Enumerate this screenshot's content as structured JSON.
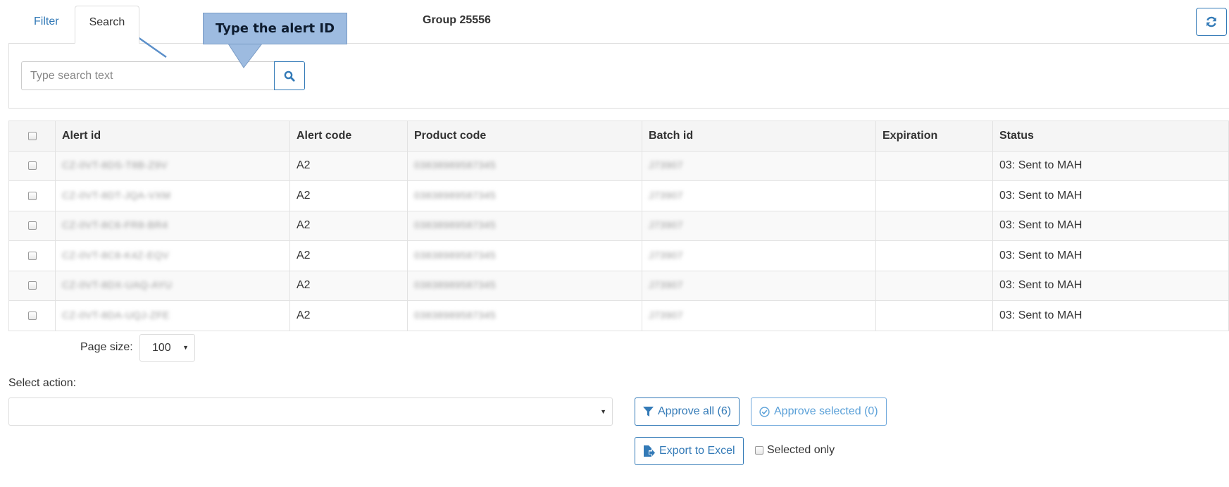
{
  "tabs": [
    {
      "label": "Filter",
      "active": false
    },
    {
      "label": "Search",
      "active": true
    }
  ],
  "group_title": "Group 25556",
  "callout": {
    "text": "Type the alert ID"
  },
  "search": {
    "placeholder": "Type search text",
    "value": ""
  },
  "table": {
    "columns": [
      "Alert id",
      "Alert code",
      "Product code",
      "Batch id",
      "Expiration",
      "Status"
    ],
    "rows": [
      {
        "alert_id": "CZ-0VT-8DS-T8B-Z9V",
        "alert_code": "A2",
        "product_code": "03838989587345",
        "batch_id": "J73907",
        "expiration": "",
        "status": "03: Sent to MAH"
      },
      {
        "alert_id": "CZ-0VT-8DT-JQA-VXM",
        "alert_code": "A2",
        "product_code": "03838989587345",
        "batch_id": "J73907",
        "expiration": "",
        "status": "03: Sent to MAH"
      },
      {
        "alert_id": "CZ-0VT-8C6-FR8-BR4",
        "alert_code": "A2",
        "product_code": "03838989587345",
        "batch_id": "J73907",
        "expiration": "",
        "status": "03: Sent to MAH"
      },
      {
        "alert_id": "CZ-0VT-8C8-K4Z-EQV",
        "alert_code": "A2",
        "product_code": "03838989587345",
        "batch_id": "J73907",
        "expiration": "",
        "status": "03: Sent to MAH"
      },
      {
        "alert_id": "CZ-0VT-8DX-UAQ-AYU",
        "alert_code": "A2",
        "product_code": "03838989587345",
        "batch_id": "J73907",
        "expiration": "",
        "status": "03: Sent to MAH"
      },
      {
        "alert_id": "CZ-0VT-8DA-UQJ-ZFE",
        "alert_code": "A2",
        "product_code": "03838989587345",
        "batch_id": "J73907",
        "expiration": "",
        "status": "03: Sent to MAH"
      }
    ]
  },
  "pager": {
    "label": "Page size:",
    "value": "100"
  },
  "actions": {
    "select_label": "Select action:",
    "select_value": "",
    "approve_all": "Approve all (6)",
    "approve_selected": "Approve selected (0)",
    "export": "Export to Excel",
    "selected_only": "Selected only"
  },
  "icons": {
    "refresh": "refresh-icon",
    "search": "search-icon",
    "filter": "filter-icon",
    "check_circle": "check-circle-icon",
    "excel": "file-export-icon"
  },
  "colors": {
    "accent": "#337ab7",
    "callout_fill": "#9dbbe0",
    "callout_arrow": "#5b8fc9"
  }
}
